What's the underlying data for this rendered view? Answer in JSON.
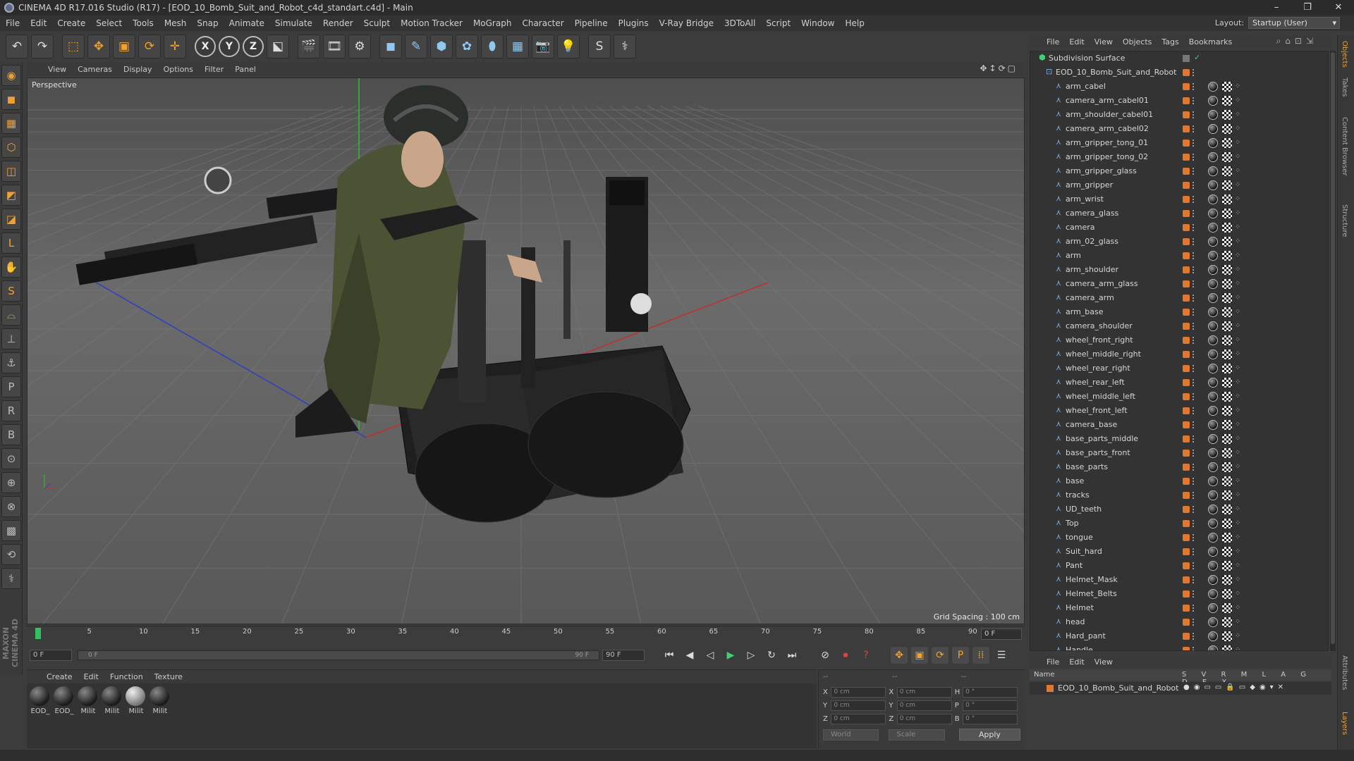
{
  "window": {
    "title": "CINEMA 4D R17.016 Studio (R17) - [EOD_10_Bomb_Suit_and_Robot_c4d_standart.c4d] - Main",
    "controls": [
      "–",
      "❐",
      "✕"
    ]
  },
  "menubar": {
    "items": [
      "File",
      "Edit",
      "Create",
      "Select",
      "Tools",
      "Mesh",
      "Snap",
      "Animate",
      "Simulate",
      "Render",
      "Sculpt",
      "Motion Tracker",
      "MoGraph",
      "Character",
      "Pipeline",
      "Plugins",
      "V-Ray Bridge",
      "3DToAll",
      "Script",
      "Window",
      "Help"
    ],
    "layout_label": "Layout:",
    "layout_value": "Startup (User)"
  },
  "toolbar": {
    "buttons": [
      {
        "name": "undo-icon",
        "glyph": "↶"
      },
      {
        "name": "redo-icon",
        "glyph": "↷"
      },
      {
        "name": "live-selection-icon",
        "glyph": "⬚"
      },
      {
        "name": "move-icon",
        "glyph": "✥"
      },
      {
        "name": "scale-icon",
        "glyph": "▣"
      },
      {
        "name": "rotate-icon",
        "glyph": "⟳"
      },
      {
        "name": "transform-icon",
        "glyph": "✛"
      },
      {
        "name": "x-axis-icon",
        "glyph": "X"
      },
      {
        "name": "y-axis-icon",
        "glyph": "Y"
      },
      {
        "name": "z-axis-icon",
        "glyph": "Z"
      },
      {
        "name": "coordinate-system-icon",
        "glyph": "⬕"
      },
      {
        "name": "render-view-icon",
        "glyph": "🎬"
      },
      {
        "name": "render-picture-viewer-icon",
        "glyph": "🎞"
      },
      {
        "name": "render-settings-icon",
        "glyph": "⚙"
      },
      {
        "name": "cube-icon",
        "glyph": "◼"
      },
      {
        "name": "spline-pen-icon",
        "glyph": "✎"
      },
      {
        "name": "subdivision-icon",
        "glyph": "⬢"
      },
      {
        "name": "array-icon",
        "glyph": "✿"
      },
      {
        "name": "deformer-icon",
        "glyph": "⬮"
      },
      {
        "name": "floor-icon",
        "glyph": "▦"
      },
      {
        "name": "camera-icon",
        "glyph": "📷"
      },
      {
        "name": "light-icon",
        "glyph": "💡"
      },
      {
        "name": "script-icon",
        "glyph": "S"
      },
      {
        "name": "python-icon",
        "glyph": "⚕"
      }
    ]
  },
  "leftbar": {
    "buttons": [
      "◉",
      "◼",
      "▦",
      "⬡",
      "◫",
      "◩",
      "◪",
      "L",
      "✋",
      "S",
      "⌓",
      "⊥",
      "⚓",
      "P",
      "R",
      "B",
      "⊙",
      "⊕",
      "⊗",
      "▩",
      "⟲",
      "⚕"
    ],
    "logo": "MAXON CINEMA 4D"
  },
  "viewport": {
    "menu": [
      "View",
      "Cameras",
      "Display",
      "Options",
      "Filter",
      "Panel"
    ],
    "camera_label": "Perspective",
    "grid_spacing": "Grid Spacing : 100 cm"
  },
  "timeline": {
    "ticks": [
      "0",
      "5",
      "10",
      "15",
      "20",
      "25",
      "30",
      "35",
      "40",
      "45",
      "50",
      "55",
      "60",
      "65",
      "70",
      "75",
      "80",
      "85",
      "90"
    ],
    "current_frame": "0 F",
    "start_field": "0 F",
    "range_start": "0 F",
    "range_end": "90 F",
    "end_field": "90 F"
  },
  "materials": {
    "menu": [
      "Create",
      "Edit",
      "Function",
      "Texture"
    ],
    "items": [
      {
        "label": "EOD_",
        "light": false
      },
      {
        "label": "EOD_",
        "light": false
      },
      {
        "label": "Milit",
        "light": false
      },
      {
        "label": "Milit",
        "light": false
      },
      {
        "label": "Milit",
        "light": true
      },
      {
        "label": "Milit",
        "light": false
      }
    ]
  },
  "coordinates": {
    "header_left": "--",
    "header_mid": "--",
    "header_right": "--",
    "rows": [
      {
        "a": "X",
        "av": "0 cm",
        "b": "X",
        "bv": "0 cm",
        "c": "H",
        "cv": "0 °"
      },
      {
        "a": "Y",
        "av": "0 cm",
        "b": "Y",
        "bv": "0 cm",
        "c": "P",
        "cv": "0 °"
      },
      {
        "a": "Z",
        "av": "0 cm",
        "b": "Z",
        "bv": "0 cm",
        "c": "B",
        "cv": "0 °"
      }
    ],
    "mode1": "World",
    "mode2": "Scale",
    "apply": "Apply"
  },
  "object_manager": {
    "menu": [
      "File",
      "Edit",
      "View",
      "Objects",
      "Tags",
      "Bookmarks"
    ],
    "root1": "Subdivision Surface",
    "root2": "EOD_10_Bomb_Suit_and_Robot",
    "objects": [
      "arm_cabel",
      "camera_arm_cabel01",
      "arm_shoulder_cabel01",
      "camera_arm_cabel02",
      "arm_gripper_tong_01",
      "arm_gripper_tong_02",
      "arm_gripper_glass",
      "arm_gripper",
      "arm_wrist",
      "camera_glass",
      "camera",
      "arm_02_glass",
      "arm",
      "arm_shoulder",
      "camera_arm_glass",
      "camera_arm",
      "arm_base",
      "camera_shoulder",
      "wheel_front_right",
      "wheel_middle_right",
      "wheel_rear_right",
      "wheel_rear_left",
      "wheel_middle_left",
      "wheel_front_left",
      "camera_base",
      "base_parts_middle",
      "base_parts_front",
      "base_parts",
      "base",
      "tracks",
      "UD_teeth",
      "Top",
      "tongue",
      "Suit_hard",
      "Pant",
      "Helmet_Mask",
      "Helmet_Belts",
      "Helmet",
      "head",
      "Hard_pant",
      "Handle"
    ]
  },
  "layer_manager": {
    "menu": [
      "File",
      "Edit",
      "View"
    ],
    "header_name": "Name",
    "header_cols": "S V R M L A G D E X",
    "row_name": "EOD_10_Bomb_Suit_and_Robot"
  },
  "right_tabs": [
    "Objects",
    "Takes",
    "Content Browser",
    "Structure",
    "Attributes",
    "Layers"
  ],
  "colors": {
    "accent": "#f0a030",
    "layer": "#e07830",
    "y_axis": "#30c030",
    "x_axis": "#c03030",
    "z_axis": "#3040c0"
  }
}
